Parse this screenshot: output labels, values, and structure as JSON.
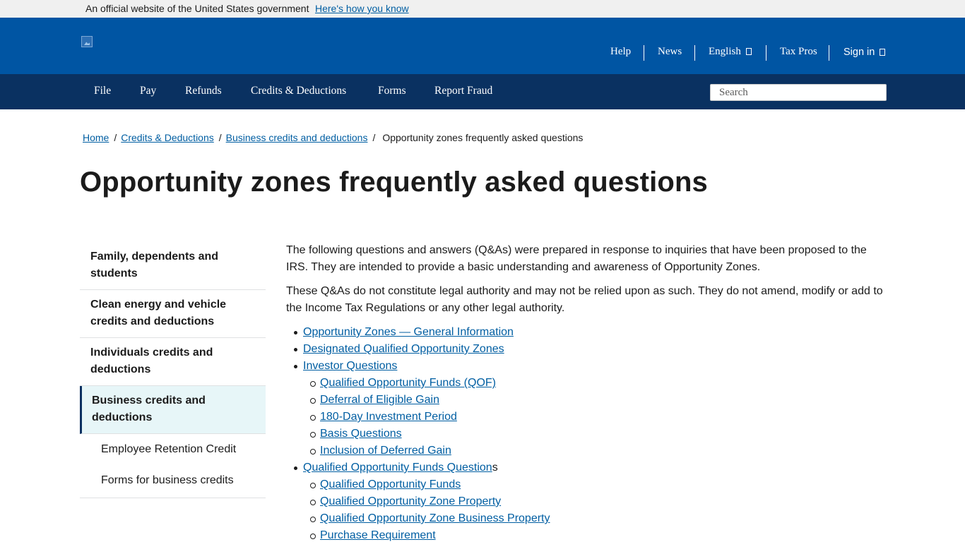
{
  "gov_banner": {
    "text": "An official website of the United States government",
    "link": "Here's how you know"
  },
  "header": {
    "logo_icon": "irs-logo-broken-image-icon",
    "utility_nav": {
      "help": "Help",
      "news": "News",
      "language": "English",
      "tax_pros": "Tax Pros",
      "sign_in": "Sign in"
    }
  },
  "main_nav": {
    "items": [
      "File",
      "Pay",
      "Refunds",
      "Credits & Deductions",
      "Forms",
      "Report Fraud"
    ],
    "search_placeholder": "Search"
  },
  "breadcrumb": {
    "items": [
      "Home",
      "Credits & Deductions",
      "Business credits and deductions"
    ],
    "current": "Opportunity zones frequently asked questions"
  },
  "page": {
    "title": "Opportunity zones frequently asked questions"
  },
  "sidenav": {
    "items": [
      "Family, dependents and students",
      "Clean energy and vehicle credits and deductions",
      "Individuals credits and deductions",
      "Business credits and deductions"
    ],
    "active_index": 3,
    "subitems": [
      "Employee Retention Credit",
      "Forms for business credits"
    ]
  },
  "content": {
    "paragraphs": [
      "The following questions and answers (Q&As) were prepared in response to inquiries that have been proposed to the IRS. They are intended to provide a basic understanding and awareness of Opportunity Zones.",
      "These Q&As do not constitute legal authority and may not be relied upon as such. They do not amend, modify or add to the Income Tax Regulations or any other legal authority."
    ],
    "links": {
      "general": "Opportunity Zones — General Information",
      "designated": "Designated Qualified Opportunity Zones",
      "investor": "Investor Questions",
      "investor_sub": [
        "Qualified Opportunity Funds (QOF)",
        "Deferral of Eligible Gain",
        "180-Day Investment Period",
        "Basis Questions",
        "Inclusion of Deferred Gain"
      ],
      "qof_questions_link": "Qualified Opportunity Funds Question",
      "qof_questions_tail": "s",
      "qof_sub": [
        "Qualified Opportunity Funds",
        "Qualified Opportunity Zone Property",
        "Qualified Opportunity Zone Business Property",
        "Purchase Requirement"
      ]
    }
  }
}
